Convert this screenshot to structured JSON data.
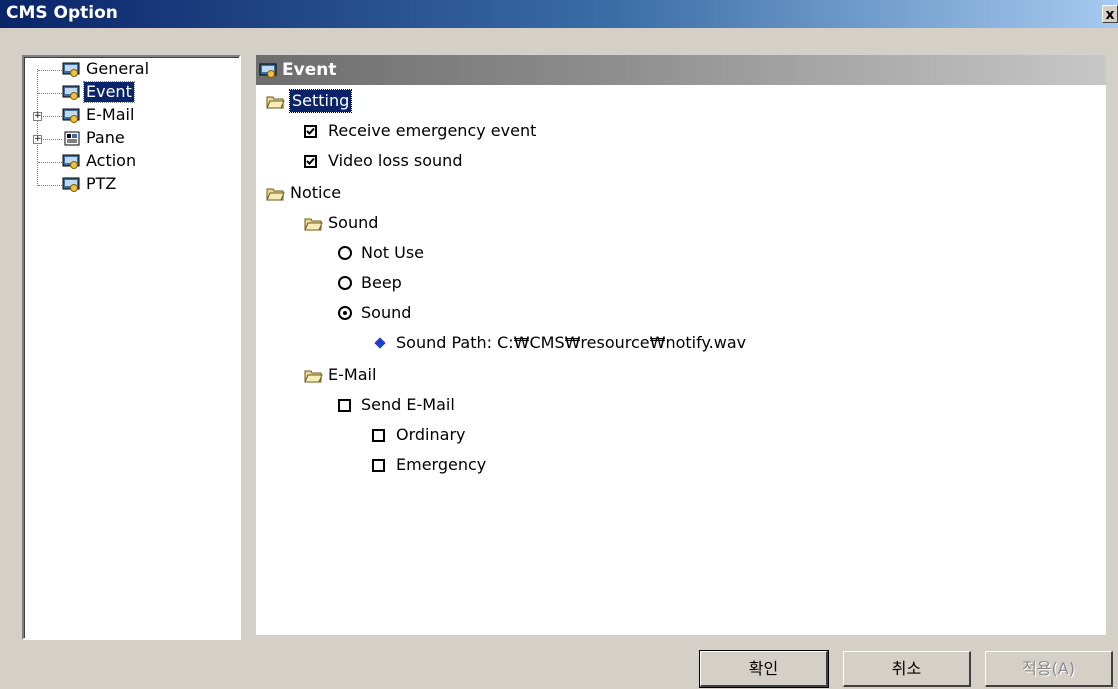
{
  "window": {
    "title": "CMS Option",
    "close_label": "x"
  },
  "tree": {
    "items": [
      {
        "label": "General"
      },
      {
        "label": "Event"
      },
      {
        "label": "E-Mail"
      },
      {
        "label": "Pane"
      },
      {
        "label": "Action"
      },
      {
        "label": "PTZ"
      }
    ]
  },
  "content": {
    "header": "Event",
    "setting": {
      "label": "Setting",
      "receive_emergency": "Receive emergency event",
      "video_loss": "Video loss sound"
    },
    "notice": {
      "label": "Notice",
      "sound": {
        "label": "Sound",
        "not_use": "Not Use",
        "beep": "Beep",
        "sound": "Sound",
        "sound_path": "Sound Path: C:₩CMS₩resource₩notify.wav"
      },
      "email": {
        "label": "E-Mail",
        "send": "Send E-Mail",
        "ordinary": "Ordinary",
        "emergency": "Emergency"
      }
    }
  },
  "buttons": {
    "ok": "확인",
    "cancel": "취소",
    "apply": "적용(A)"
  },
  "colors": {
    "title_bar": "#0a246a",
    "selection": "#0a246a",
    "diamond": "#1b3fc8"
  }
}
